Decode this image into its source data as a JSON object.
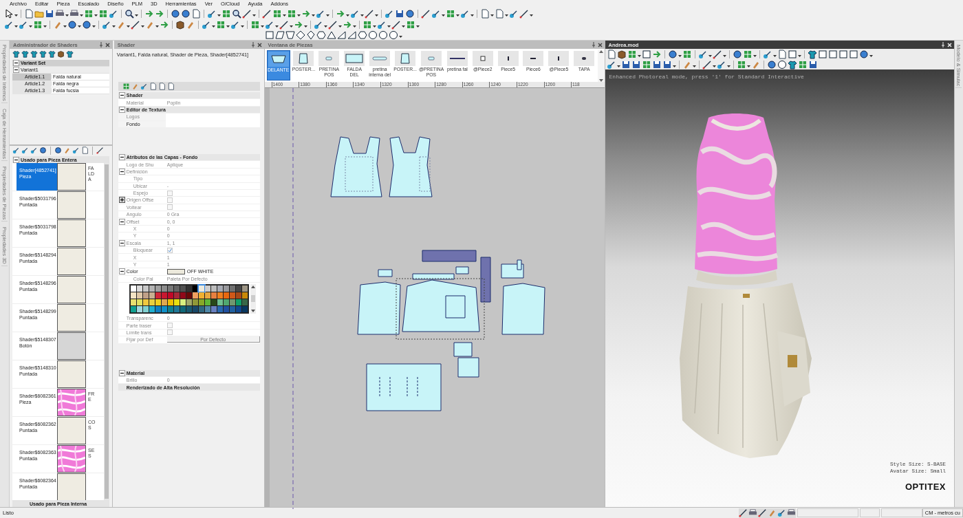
{
  "menu": [
    "Archivo",
    "Editar",
    "Pieza",
    "Escalado",
    "Diseño",
    "PLM",
    "3D",
    "Herramientas",
    "Ver",
    "O/Cloud",
    "Ayuda",
    "Addons"
  ],
  "side_tabs": [
    "Propiedades de Internos",
    "Caja de Herramientas",
    "Propiedades de Piezas",
    "Propiedades 3D"
  ],
  "shader_manager": {
    "title": "Administrador de Shaders",
    "variant_set": {
      "label": "Variant Set",
      "expanded": true,
      "variants": [
        {
          "label": "Variant1",
          "expanded": true,
          "articles": [
            {
              "name": "Article1.1",
              "value": "Falda natural",
              "selected": true
            },
            {
              "name": "Article1.2",
              "value": "Falda negra",
              "selected": false
            },
            {
              "name": "Article1.3",
              "value": "Falda fucsia",
              "selected": false
            }
          ]
        }
      ]
    },
    "used_whole": {
      "label": "Usado para Pieza Entera",
      "expanded": true,
      "shaders": [
        {
          "name": "Shader[4852741]",
          "type": "Pieza",
          "kind": "solid",
          "color": "#efece2",
          "note": "FALDA",
          "selected": true
        },
        {
          "name": "Shader$5031796",
          "type": "Puntada",
          "kind": "solid",
          "color": "#efece2",
          "selected": false
        },
        {
          "name": "Shader$5031798",
          "type": "Puntada",
          "kind": "solid",
          "color": "#efece2",
          "selected": false
        },
        {
          "name": "Shader$5148294",
          "type": "Puntada",
          "kind": "solid",
          "color": "#efece2",
          "selected": false
        },
        {
          "name": "Shader$5148296",
          "type": "Puntada",
          "kind": "solid",
          "color": "#efece2",
          "selected": false
        },
        {
          "name": "Shader$5148299",
          "type": "Puntada",
          "kind": "solid",
          "color": "#efece2",
          "selected": false
        },
        {
          "name": "Shader$5148307",
          "type": "Botón",
          "kind": "solid",
          "color": "#d6d6d6",
          "selected": false
        },
        {
          "name": "Shader$5148310",
          "type": "Puntada",
          "kind": "solid",
          "color": "#efece2",
          "selected": false
        },
        {
          "name": "Shader$6082361",
          "type": "Pieza",
          "kind": "marble",
          "color": "#f07ad8",
          "note": "FRE",
          "selected": false
        },
        {
          "name": "Shader$6082362",
          "type": "Puntada",
          "kind": "solid",
          "color": "#efece2",
          "note": "COS",
          "selected": false
        },
        {
          "name": "Shader$6082363",
          "type": "Puntada",
          "kind": "marble",
          "color": "#f07ad8",
          "note": "SES",
          "selected": false
        },
        {
          "name": "Shader$6082364",
          "type": "Puntada",
          "kind": "solid",
          "color": "#efece2",
          "selected": false
        }
      ]
    },
    "used_inner": {
      "label": "Usado para Pieza Interna"
    }
  },
  "shader_panel": {
    "title": "Shader",
    "path": "Variant1, Falda natural, Shader de Pieza, Shader[4852741]",
    "groups": [
      {
        "rows": [
          {
            "kind": "section",
            "label": "Shader",
            "expanded": true
          },
          {
            "kind": "prop",
            "label": "Material",
            "value": "Poplin"
          },
          {
            "kind": "section",
            "label": "Editor de Textura",
            "expanded": true
          },
          {
            "kind": "layer",
            "label": "Logos",
            "selected": false
          },
          {
            "kind": "layer",
            "label": "Fondo",
            "selected": true
          }
        ]
      },
      {
        "rows": [
          {
            "kind": "section",
            "label": "Atributos de las Capas - Fondo",
            "expanded": true
          },
          {
            "kind": "prop",
            "label": "Logo de Shu",
            "value": "Aplique"
          },
          {
            "kind": "prop",
            "label": "Definición",
            "expanded": true,
            "children": [
              {
                "kind": "prop",
                "label": "Tipo"
              },
              {
                "kind": "prop",
                "label": "Ubicar",
                "value": "-"
              },
              {
                "kind": "check",
                "label": "Espejo",
                "checked": false
              }
            ]
          },
          {
            "kind": "check",
            "label": "Origen Offse",
            "expanded": false,
            "checked": false
          },
          {
            "kind": "check",
            "label": "Voltear",
            "checked": false
          },
          {
            "kind": "prop",
            "label": "Angulo",
            "value": "0 Gra"
          },
          {
            "kind": "prop",
            "label": "Offset",
            "value": "0, 0",
            "expanded": true,
            "children": [
              {
                "kind": "prop",
                "label": "X",
                "value": "0"
              },
              {
                "kind": "prop",
                "label": "Y",
                "value": "0"
              }
            ]
          },
          {
            "kind": "prop",
            "label": "Escala",
            "value": "1, 1",
            "expanded": true,
            "children": [
              {
                "kind": "check",
                "label": "Bloquear",
                "checked": true
              },
              {
                "kind": "prop",
                "label": "X",
                "value": "1"
              },
              {
                "kind": "prop",
                "label": "Y",
                "value": "1"
              }
            ]
          },
          {
            "kind": "color",
            "label": "Color",
            "value": "OFF WHITE",
            "color": "#ece9dc",
            "expanded": true,
            "children": [
              {
                "kind": "prop",
                "label": "Color Pal",
                "value": "Paleta Por Defecto"
              }
            ]
          },
          {
            "kind": "palette",
            "swatches": [
              {
                "color": "#ffffff",
                "selected": false
              },
              {
                "color": "#dcdcdc",
                "selected": false
              },
              {
                "color": "#c8c8c8",
                "selected": false
              },
              {
                "color": "#b4b4b4",
                "selected": false
              },
              {
                "color": "#a0a0a0",
                "selected": false
              },
              {
                "color": "#8c8c8c",
                "selected": false
              },
              {
                "color": "#787878",
                "selected": false
              },
              {
                "color": "#646464",
                "selected": false
              },
              {
                "color": "#505050",
                "selected": false
              },
              {
                "color": "#323232",
                "selected": false
              },
              {
                "color": "#000000",
                "selected": false
              },
              {
                "color": "#ece9dc",
                "selected": true
              },
              {
                "color": "#cfcfcf",
                "selected": false
              },
              {
                "color": "#bcbcbc",
                "selected": false
              },
              {
                "color": "#a8abb4",
                "selected": false
              },
              {
                "color": "#98989c",
                "selected": false
              },
              {
                "color": "#707070",
                "selected": false
              },
              {
                "color": "#464646",
                "selected": false
              },
              {
                "color": "#9c9484",
                "selected": false
              },
              {
                "color": "#f4e4c4",
                "selected": false
              },
              {
                "color": "#e0c8a8",
                "selected": false
              },
              {
                "color": "#c0a088",
                "selected": false
              },
              {
                "color": "#c8b090",
                "selected": false
              },
              {
                "color": "#d02838",
                "selected": false
              },
              {
                "color": "#c81830",
                "selected": false
              },
              {
                "color": "#c00828",
                "selected": false
              },
              {
                "color": "#a82838",
                "selected": false
              },
              {
                "color": "#900818",
                "selected": false
              },
              {
                "color": "#680808",
                "selected": false
              },
              {
                "color": "#f0a060",
                "selected": false
              },
              {
                "color": "#f0b030",
                "selected": false
              },
              {
                "color": "#e8a840",
                "selected": false
              },
              {
                "color": "#e88040",
                "selected": false
              },
              {
                "color": "#f08020",
                "selected": false
              },
              {
                "color": "#e86810",
                "selected": false
              },
              {
                "color": "#d05818",
                "selected": false
              },
              {
                "color": "#a84818",
                "selected": false
              },
              {
                "color": "#c88808",
                "selected": false
              },
              {
                "color": "#e8e070",
                "selected": false
              },
              {
                "color": "#e0e060",
                "selected": false
              },
              {
                "color": "#f0c840",
                "selected": false
              },
              {
                "color": "#e8d040",
                "selected": false
              },
              {
                "color": "#f0d020",
                "selected": false
              },
              {
                "color": "#e0a850",
                "selected": false
              },
              {
                "color": "#f0c000",
                "selected": false
              },
              {
                "color": "#e8e010",
                "selected": false
              },
              {
                "color": "#d8f080",
                "selected": false
              },
              {
                "color": "#a0a868",
                "selected": false
              },
              {
                "color": "#909838",
                "selected": false
              },
              {
                "color": "#88a828",
                "selected": false
              },
              {
                "color": "#60b838",
                "selected": false
              },
              {
                "color": "#284818",
                "selected": false
              },
              {
                "color": "#70c090",
                "selected": false
              },
              {
                "color": "#50a870",
                "selected": false
              },
              {
                "color": "#709870",
                "selected": false
              },
              {
                "color": "#10a068",
                "selected": false
              },
              {
                "color": "#386848",
                "selected": false
              },
              {
                "color": "#10a090",
                "selected": false
              },
              {
                "color": "#a0d8e0",
                "selected": false
              },
              {
                "color": "#80d0d0",
                "selected": false
              },
              {
                "color": "#20b0d0",
                "selected": false
              },
              {
                "color": "#1080c0",
                "selected": false
              },
              {
                "color": "#1090c8",
                "selected": false
              },
              {
                "color": "#108090",
                "selected": false
              },
              {
                "color": "#207898",
                "selected": false
              },
              {
                "color": "#106878",
                "selected": false
              },
              {
                "color": "#185870",
                "selected": false
              },
              {
                "color": "#184868",
                "selected": false
              },
              {
                "color": "#306880",
                "selected": false
              },
              {
                "color": "#5088a8",
                "selected": false
              },
              {
                "color": "#6880c0",
                "selected": false
              },
              {
                "color": "#2868b0",
                "selected": false
              },
              {
                "color": "#2050a0",
                "selected": false
              },
              {
                "color": "#2060a0",
                "selected": false
              },
              {
                "color": "#104890",
                "selected": false
              },
              {
                "color": "#083860",
                "selected": false
              }
            ]
          },
          {
            "kind": "prop",
            "label": "Transparenc",
            "value": "0"
          },
          {
            "kind": "check",
            "label": "Parte traser",
            "checked": false
          },
          {
            "kind": "check",
            "label": "Límite trans",
            "checked": false
          },
          {
            "kind": "button",
            "label": "Fijar por Def",
            "value": "Por Defecto"
          }
        ]
      },
      {
        "rows": [
          {
            "kind": "section",
            "label": "Material",
            "expanded": true
          },
          {
            "kind": "prop",
            "label": "Brillo",
            "value": "0"
          },
          {
            "kind": "section",
            "label": "Renderizado de Alta Resolución"
          }
        ]
      }
    ]
  },
  "pieces_window": {
    "title": "Ventana de Piezas",
    "pieces": [
      {
        "label": "DELANTE",
        "kind": "trapezoid",
        "selected": true
      },
      {
        "label": "POSTER...",
        "kind": "tall",
        "selected": false
      },
      {
        "label": "PRETINA POS",
        "kind": "small-band",
        "selected": false
      },
      {
        "label": "FALDA DEL",
        "kind": "wide",
        "selected": false
      },
      {
        "label": "pretina interna del",
        "kind": "band",
        "selected": false
      },
      {
        "label": "POSTER...",
        "kind": "tall",
        "selected": false
      },
      {
        "label": "@PRETINA POS",
        "kind": "small-band",
        "selected": false
      },
      {
        "label": "pretina fal",
        "kind": "bar",
        "selected": false
      },
      {
        "label": "@Piece2",
        "kind": "square",
        "selected": false
      },
      {
        "label": "Piece5",
        "kind": "vline",
        "selected": false
      },
      {
        "label": "Piece6",
        "kind": "hline",
        "selected": false
      },
      {
        "label": "@Piece5",
        "kind": "vline",
        "selected": false
      },
      {
        "label": "TAPA",
        "kind": "pill",
        "selected": false
      }
    ],
    "ruler": [
      "1400",
      "1380",
      "1360",
      "1340",
      "1320",
      "1300",
      "1280",
      "1260",
      "1240",
      "1220",
      "1200",
      "118"
    ]
  },
  "model_view": {
    "title": "Andrea.mod",
    "notice": "Enhanced Photoreal mode, press '1' for Standard Interactive",
    "style_size": "Style Size: S-BASE",
    "avatar_size": "Avatar Size: Small",
    "logo": "OPTITEX",
    "side_tab": "Modelo & Simulac"
  },
  "status_bar": {
    "text": "Listo",
    "units": "CM - metros cu"
  }
}
